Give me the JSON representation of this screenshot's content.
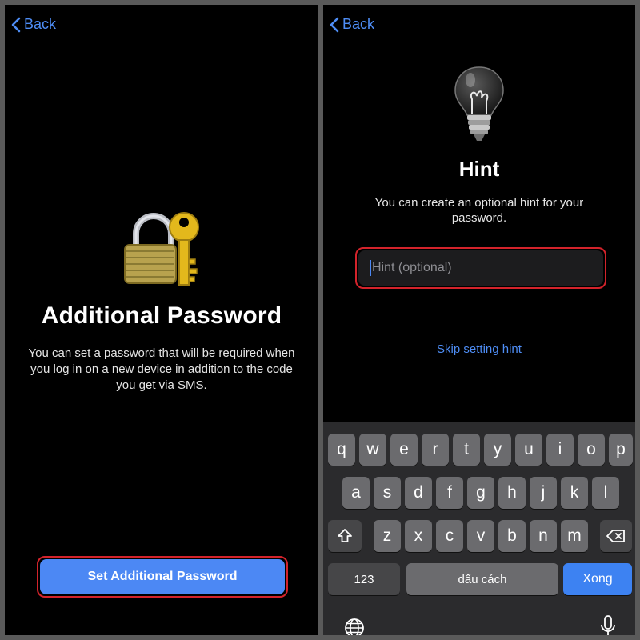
{
  "left": {
    "back_label": "Back",
    "title": "Additional Password",
    "description": "You can set a password that will be required when you log in on a new device in addition to the code you get via SMS.",
    "button_label": "Set Additional Password"
  },
  "right": {
    "back_label": "Back",
    "title": "Hint",
    "description": "You can create an optional hint for your password.",
    "hint_placeholder": "Hint (optional)",
    "hint_value": "",
    "skip_label": "Skip setting hint"
  },
  "keyboard": {
    "row1": [
      "q",
      "w",
      "e",
      "r",
      "t",
      "y",
      "u",
      "i",
      "o",
      "p"
    ],
    "row2": [
      "a",
      "s",
      "d",
      "f",
      "g",
      "h",
      "j",
      "k",
      "l"
    ],
    "row3": [
      "z",
      "x",
      "c",
      "v",
      "b",
      "n",
      "m"
    ],
    "numbers_label": "123",
    "space_label": "dấu cách",
    "done_label": "Xong",
    "icons": [
      "shift-icon",
      "backspace-icon",
      "globe-icon",
      "microphone-icon"
    ]
  },
  "colors": {
    "accent": "#4c88f4",
    "link": "#4e8df5",
    "highlight_outline": "#d3232b",
    "background": "#000000"
  }
}
